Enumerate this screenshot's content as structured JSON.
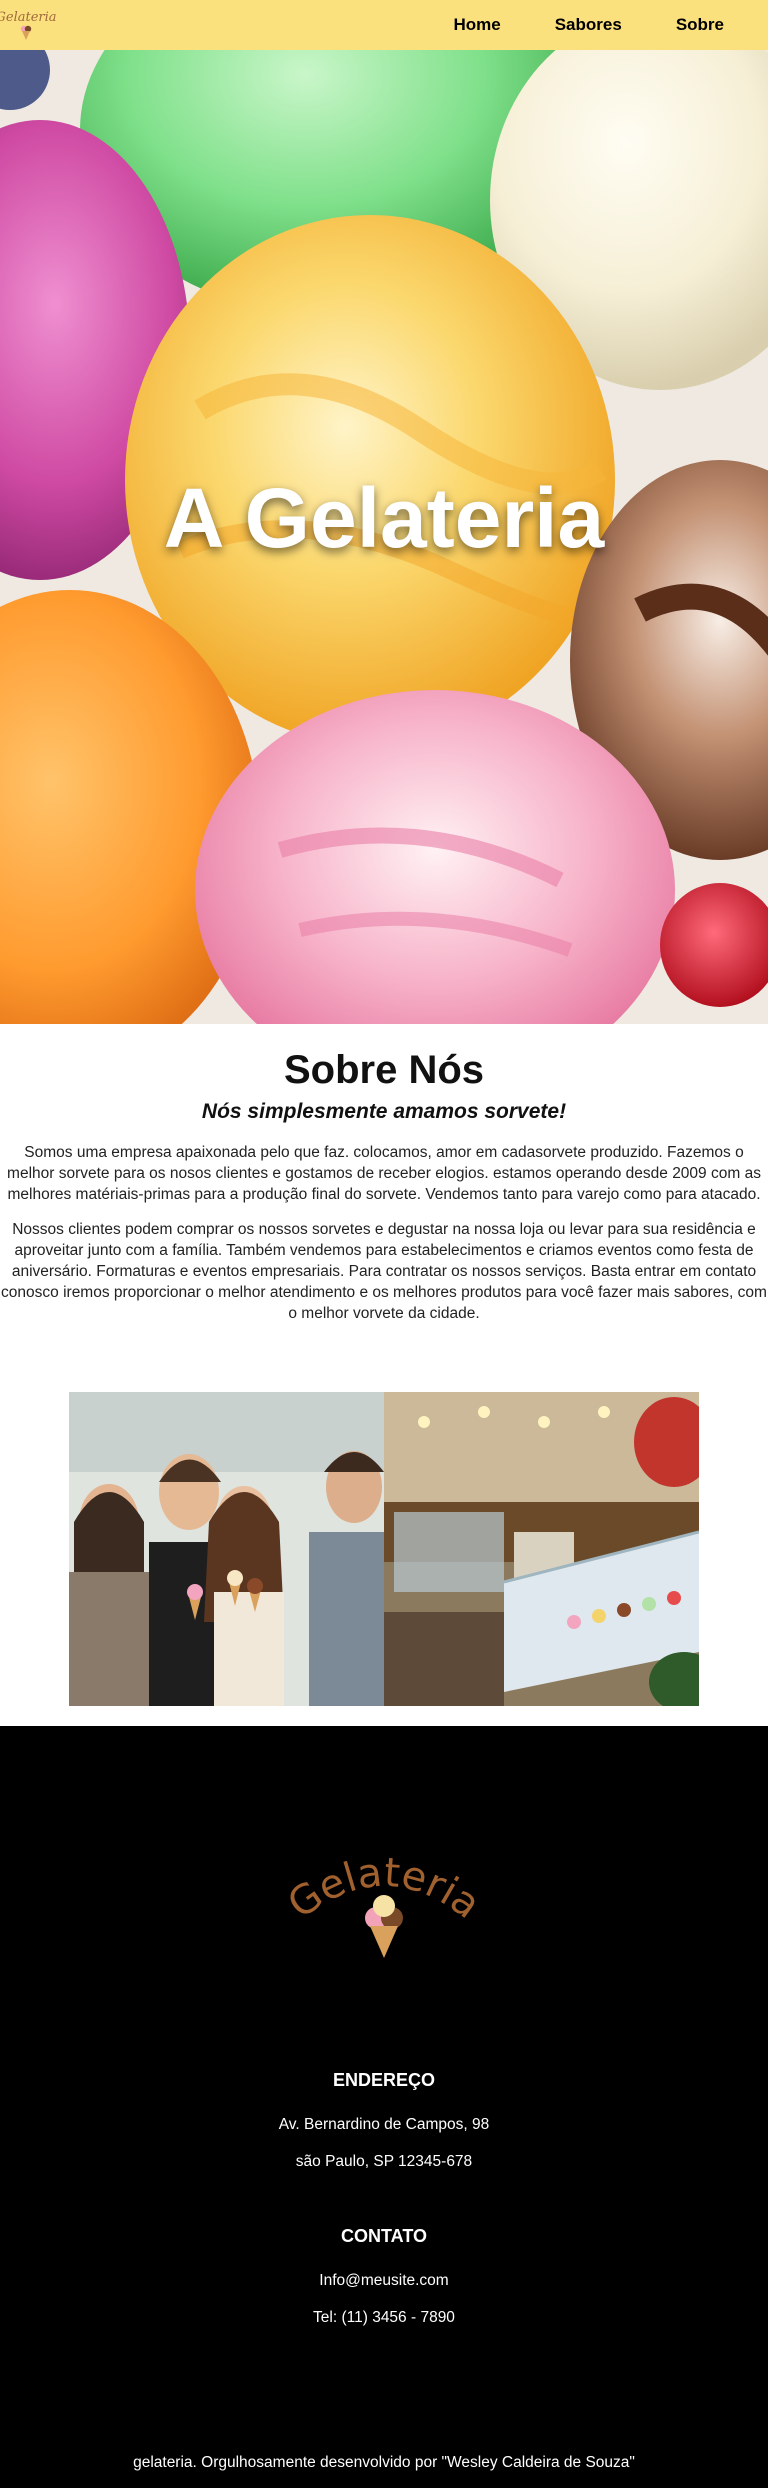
{
  "header": {
    "logo_text": "Gelateria",
    "nav": [
      {
        "label": "Home"
      },
      {
        "label": "Sabores"
      },
      {
        "label": "Sobre"
      }
    ]
  },
  "hero": {
    "title": "A Gelateria"
  },
  "about": {
    "title": "Sobre Nós",
    "subtitle": "Nós simplesmente amamos sorvete!",
    "paragraphs": [
      "Somos uma empresa apaixonada pelo que faz. colocamos, amor em cadasorvete produzido. Fazemos o melhor sorvete para os nosos clientes e gostamos de receber elogios. estamos operando desde 2009 com as melhores matériais-primas para a produção final do sorvete. Vendemos tanto para varejo como para atacado.",
      "Nossos clientes podem comprar os nossos sorvetes e degustar na nossa loja ou levar para sua residência e aproveitar junto com a família. Também vendemos para estabelecimentos e criamos eventos como festa de aniversário. Formaturas e eventos empresariais. Para contratar os nossos serviços. Basta entrar em contato conosco iremos proporcionar o melhor atendimento e os melhores produtos para você fazer mais sabores, com o melhor vorvete da cidade."
    ]
  },
  "footer": {
    "logo_text": "Gelateria",
    "address_heading": "ENDEREÇO",
    "address_lines": [
      "Av. Bernardino de Campos, 98",
      "são Paulo, SP 12345-678"
    ],
    "contact_heading": "CONTATO",
    "contact_lines": [
      "Info@meusite.com",
      "Tel: (11) 3456 - 7890"
    ],
    "copyright": "gelateria. Orgulhosamente desenvolvido por \"Wesley Caldeira de Souza\""
  },
  "colors": {
    "header_bg": "#fbe07e",
    "logo_brown": "#a06a3d",
    "footer_bg": "#000000"
  }
}
